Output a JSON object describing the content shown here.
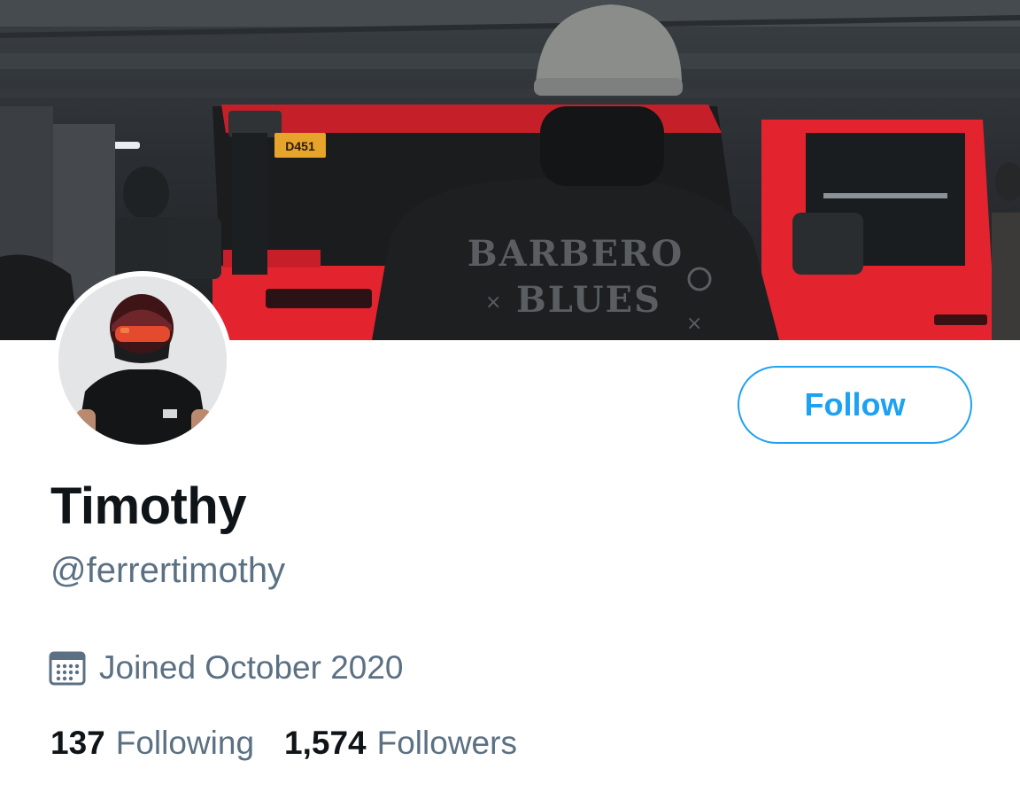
{
  "banner": {
    "plate_text": "D451",
    "shirt_line1": "BARBERO",
    "shirt_line2": "BLUES"
  },
  "profile": {
    "display_name": "Timothy",
    "handle": "@ferrertimothy",
    "joined": "Joined October 2020",
    "follow_label": "Follow"
  },
  "stats": {
    "following_count": "137",
    "following_label": "Following",
    "followers_count": "1,574",
    "followers_label": "Followers"
  },
  "colors": {
    "accent": "#1da1f2",
    "secondary_text": "#5b7083",
    "primary_text": "#0f1419",
    "jeep_red": "#e3242f"
  },
  "icons": {
    "calendar": "calendar-icon"
  }
}
